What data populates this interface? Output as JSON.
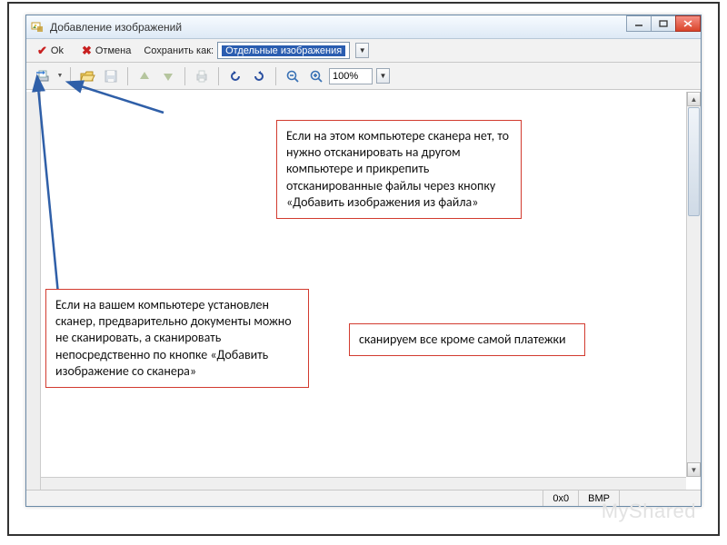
{
  "window": {
    "title": "Добавление изображений"
  },
  "toolbar1": {
    "ok_label": "Ok",
    "cancel_label": "Отмена",
    "save_as_label": "Сохранить как:",
    "save_as_value": "Отдельные изображения"
  },
  "toolbar2": {
    "zoom_value": "100%"
  },
  "status": {
    "dims": "0x0",
    "format": "BMP"
  },
  "callouts": {
    "no_scanner": "Если на этом компьютере сканера нет, то нужно отсканировать на другом компьютере и прикрепить отсканированные файлы через кнопку «Добавить изображения из файла»",
    "has_scanner": "Если на вашем компьютере установлен сканер, предварительно документы можно не сканировать, а сканировать непосредственно по кнопке «Добавить изображение со сканера»",
    "scan_note": "сканируем все кроме самой платежки"
  },
  "watermark": "MyShared"
}
